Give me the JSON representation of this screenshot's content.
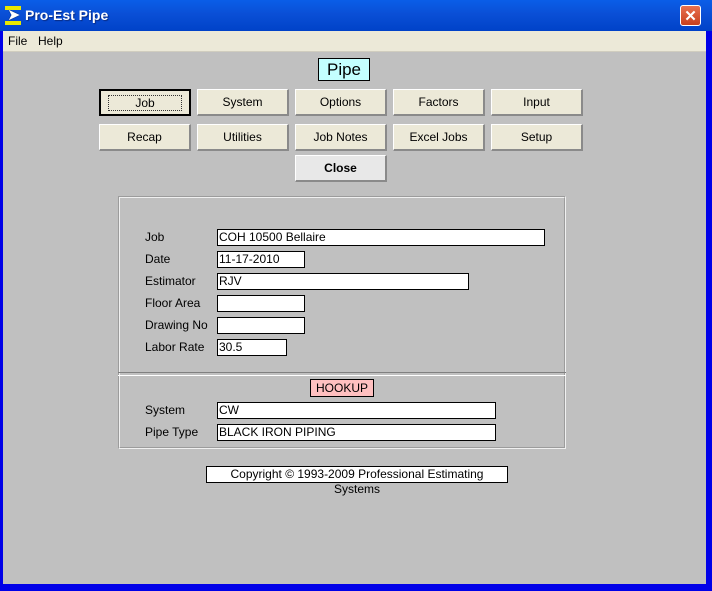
{
  "window": {
    "title": "Pro-Est Pipe",
    "close_glyph": "✕"
  },
  "menu": {
    "items": [
      "File",
      "Help"
    ]
  },
  "header_label": "Pipe",
  "buttons": {
    "row1": [
      "Job",
      "System",
      "Options",
      "Factors",
      "Input"
    ],
    "row2": [
      "Recap",
      "Utilities",
      "Job Notes",
      "Excel Jobs",
      "Setup"
    ],
    "close": "Close"
  },
  "job_form": {
    "labels": {
      "job": "Job",
      "date": "Date",
      "estimator": "Estimator",
      "floor_area": "Floor Area",
      "drawing_no": "Drawing No",
      "labor_rate": "Labor Rate"
    },
    "values": {
      "job": "COH 10500 Bellaire",
      "date": "11-17-2010",
      "estimator": "RJV",
      "floor_area": "",
      "drawing_no": "",
      "labor_rate": "30.5"
    }
  },
  "hookup": {
    "title": "HOOKUP",
    "labels": {
      "system": "System",
      "pipe_type": "Pipe Type"
    },
    "values": {
      "system": "CW",
      "pipe_type": "BLACK IRON PIPING"
    }
  },
  "copyright": "Copyright © 1993-2009 Professional Estimating Systems",
  "colors": {
    "pipe_label_bg": "#c4ffff",
    "hookup_bg": "#ffc0c0",
    "titlebar": "#0a4fd6"
  }
}
